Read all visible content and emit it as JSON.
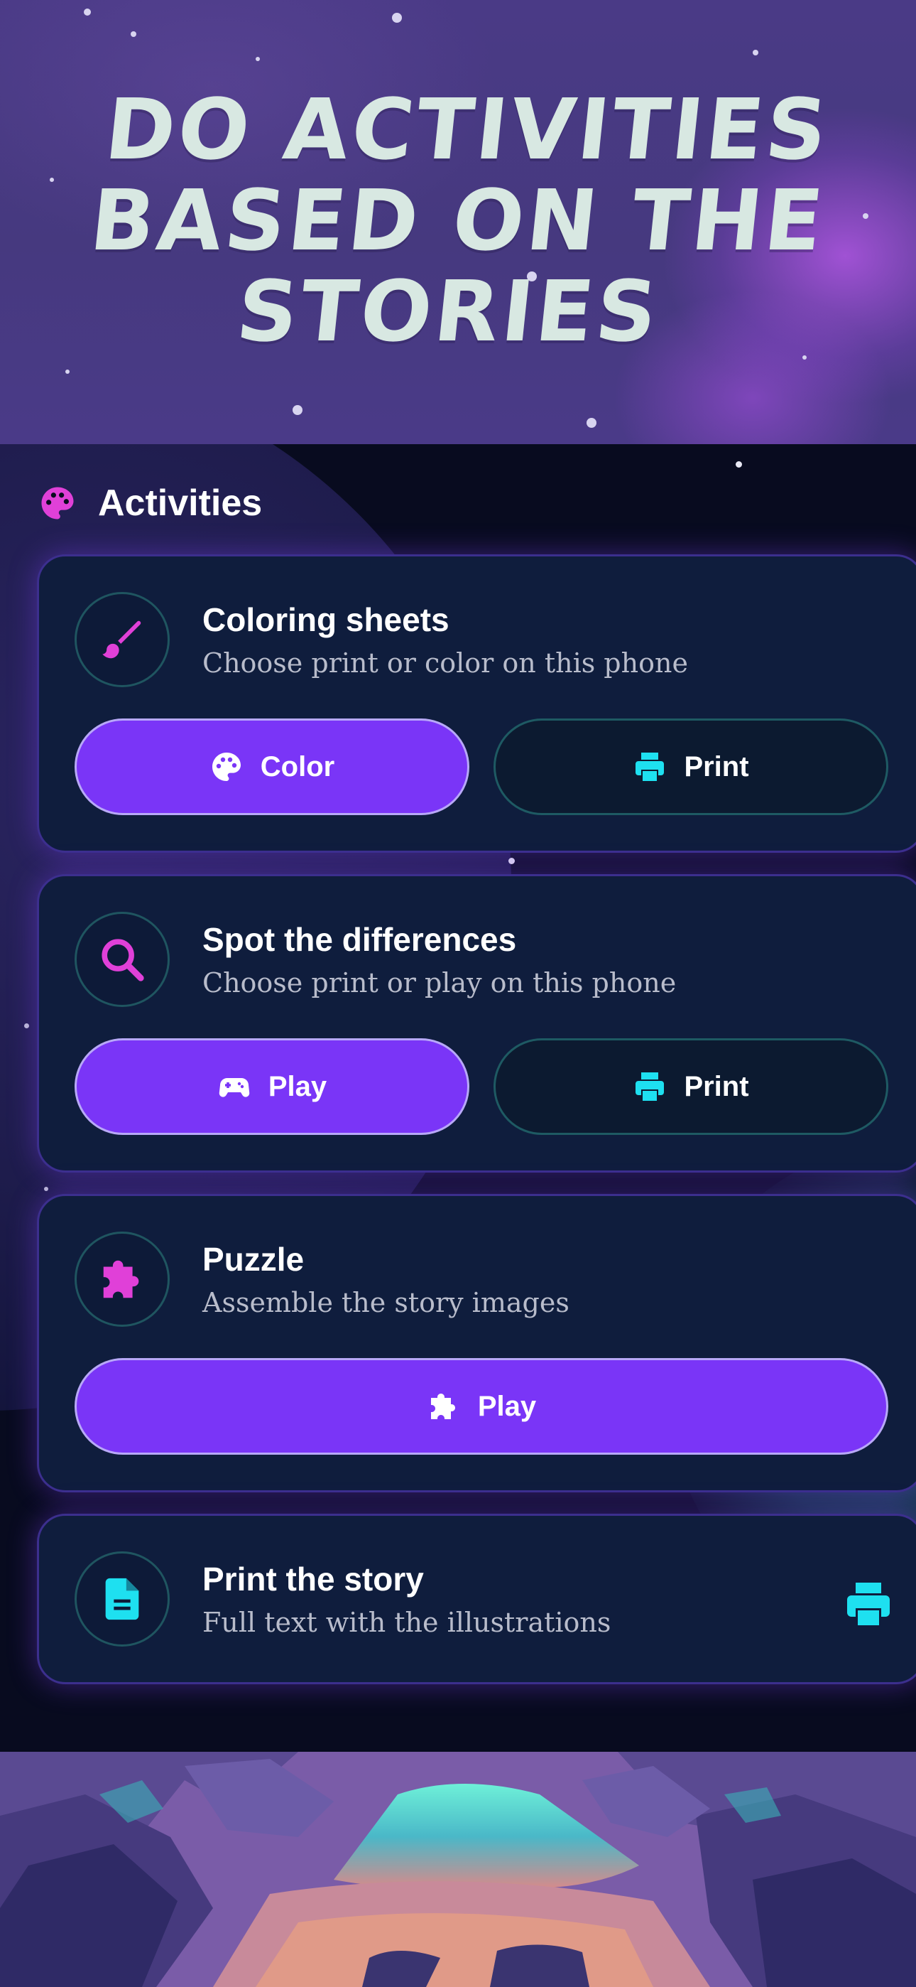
{
  "hero": {
    "title": "Do activities\nbased on the\nstories"
  },
  "section": {
    "title": "Activities",
    "icon": "palette-icon"
  },
  "cards": [
    {
      "title": "Coloring sheets",
      "subtitle": "Choose print or color on this phone",
      "icon": "paintbrush-icon",
      "buttons": [
        {
          "label": "Color",
          "icon": "palette-icon",
          "style": "primary"
        },
        {
          "label": "Print",
          "icon": "printer-icon",
          "style": "outline"
        }
      ]
    },
    {
      "title": "Spot the differences",
      "subtitle": "Choose print or play on this phone",
      "icon": "magnifier-icon",
      "buttons": [
        {
          "label": "Play",
          "icon": "gamepad-icon",
          "style": "primary"
        },
        {
          "label": "Print",
          "icon": "printer-icon",
          "style": "outline"
        }
      ]
    },
    {
      "title": "Puzzle",
      "subtitle": "Assemble the story images",
      "icon": "puzzle-icon",
      "buttons": [
        {
          "label": "Play",
          "icon": "puzzle-icon",
          "style": "primary"
        }
      ]
    },
    {
      "title": "Print the story",
      "subtitle": "Full text with the illustrations",
      "icon": "document-icon",
      "action_icon": "printer-icon"
    }
  ],
  "colors": {
    "accent_purple": "#7a35f7",
    "icon_pink": "#e040d8",
    "icon_cyan": "#1ee0f0",
    "card_bg": "#0f1d3d"
  }
}
